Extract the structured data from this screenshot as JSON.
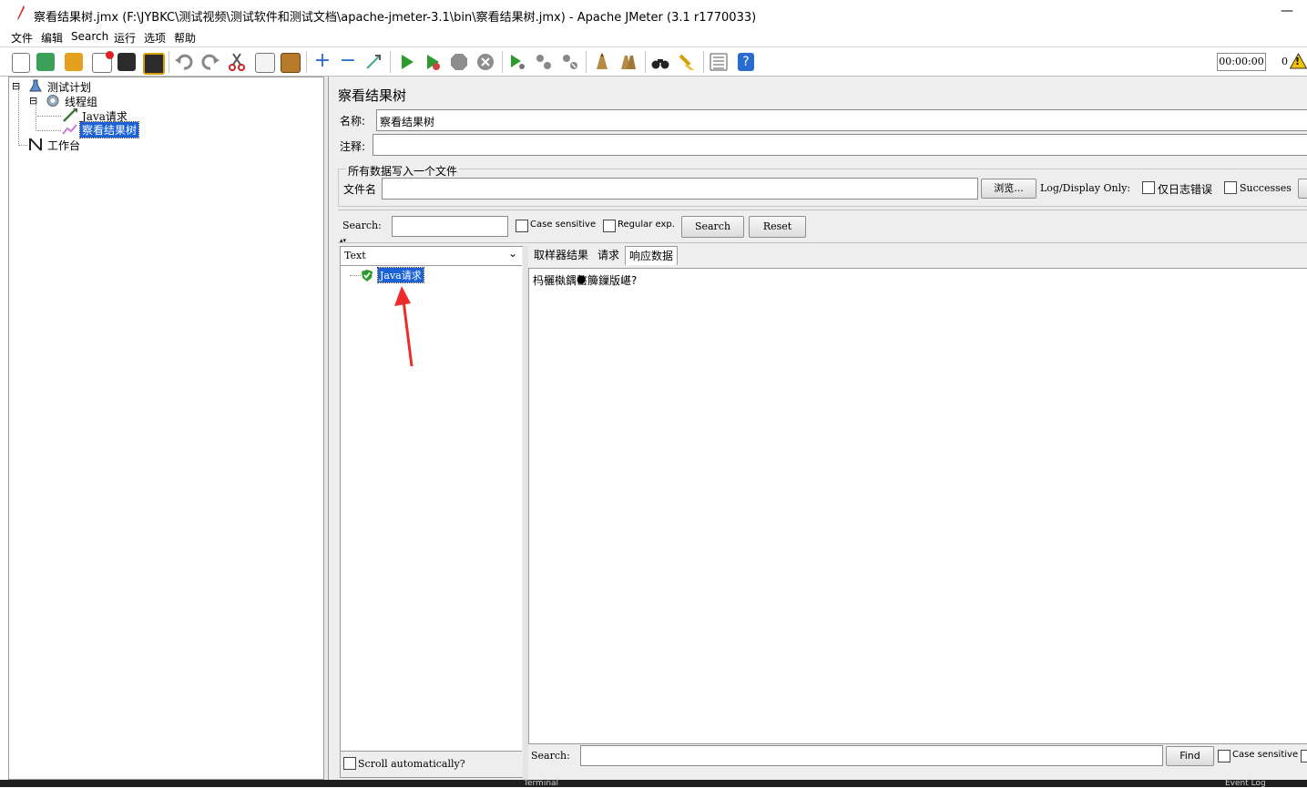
{
  "window": {
    "title": "察看结果树.jmx (F:\\JYBKC\\测试视频\\测试软件和测试文档\\apache-jmeter-3.1\\bin\\察看结果树.jmx) - Apache JMeter (3.1 r1770033)",
    "close_glyph": "—"
  },
  "menu": [
    "文件",
    "编辑",
    "Search",
    "运行",
    "选项",
    "帮助"
  ],
  "toolbar": {
    "timer": "00:00:00",
    "count": "0",
    "warn_glyph": "!"
  },
  "tree": {
    "items": [
      {
        "label": "测试计划",
        "expander": "⊟"
      },
      {
        "label": "线程组",
        "expander": "⊟"
      },
      {
        "label": "Java请求"
      },
      {
        "label": "察看结果树"
      },
      {
        "label": "工作台"
      }
    ]
  },
  "panel": {
    "title": "察看结果树",
    "name_label": "名称:",
    "name_value": "察看结果树",
    "comment_label": "注释:",
    "comment_value": "",
    "file_section_title": "所有数据写入一个文件",
    "filename_label": "文件名",
    "filename_value": "",
    "browse_button": "浏览...",
    "log_display_label": "Log/Display Only:",
    "errors_only_label": "仅日志错误",
    "successes_label": "Successes"
  },
  "search": {
    "label": "Search:",
    "value": "",
    "case_sensitive": "Case sensitive",
    "regular_exp": "Regular exp.",
    "search_button": "Search",
    "reset_button": "Reset"
  },
  "results": {
    "renderer_selected": "Text",
    "renderer_arrow": "⌄",
    "sample": "Java请求",
    "scroll_auto": "Scroll automatically?",
    "tabs": [
      "取样器结果",
      "请求",
      "响应数据"
    ],
    "active_tab": 2,
    "response_text": "杩欐槸鍝嶅簲鏁版嵁?",
    "response_dot": "●",
    "bottom_search_label": "Search:",
    "bottom_search_value": "",
    "find_button": "Find",
    "bottom_case_sensitive": "Case sensitive"
  },
  "taskbar": {
    "terminal": "Terminal",
    "event_log": "Event Log"
  },
  "colors": {
    "selection": "#1a62d6",
    "play_green": "#2e9b2e",
    "stop_gray": "#8d8d8d",
    "help_blue": "#2a6bd0",
    "annotation_red": "#ee2b2b"
  }
}
